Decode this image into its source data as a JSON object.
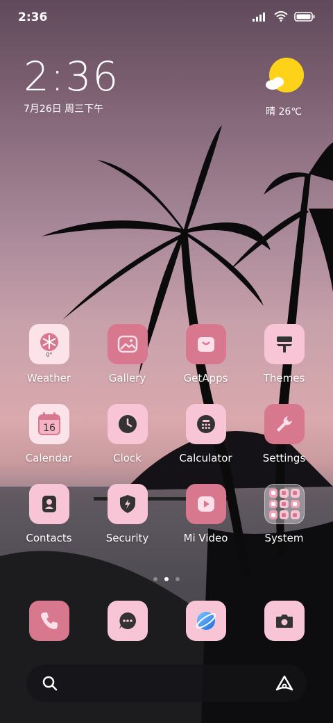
{
  "status_bar": {
    "time": "2:36"
  },
  "clock_widget": {
    "time": "2:36",
    "date": "7月26日 周三下午"
  },
  "weather_widget": {
    "text": "晴 26℃"
  },
  "apps": [
    {
      "label": "Weather",
      "icon": "snowflake-icon"
    },
    {
      "label": "Gallery",
      "icon": "image-icon"
    },
    {
      "label": "GetApps",
      "icon": "shopping-bag-icon"
    },
    {
      "label": "Themes",
      "icon": "paint-roller-icon"
    },
    {
      "label": "Calendar",
      "icon": "calendar-icon",
      "icon_text": "16"
    },
    {
      "label": "Clock",
      "icon": "clock-icon"
    },
    {
      "label": "Calculator",
      "icon": "calculator-icon"
    },
    {
      "label": "Settings",
      "icon": "wrench-icon"
    },
    {
      "label": "Contacts",
      "icon": "contact-card-icon"
    },
    {
      "label": "Security",
      "icon": "shield-lightning-icon"
    },
    {
      "label": "Mi Video",
      "icon": "play-icon"
    },
    {
      "label": "System",
      "icon": "folder-icon"
    }
  ],
  "page_indicator": {
    "pages": 3,
    "active": 2
  },
  "dock": [
    {
      "icon": "phone-icon"
    },
    {
      "icon": "message-icon"
    },
    {
      "icon": "browser-icon"
    },
    {
      "icon": "camera-icon"
    }
  ],
  "search_bar": {
    "left_icon": "search-icon",
    "right_icon": "assistant-icon"
  },
  "colors": {
    "icon_light": "#f7c5d5",
    "icon_dark": "#d8788f",
    "weather_sun": "#ffd21a"
  }
}
